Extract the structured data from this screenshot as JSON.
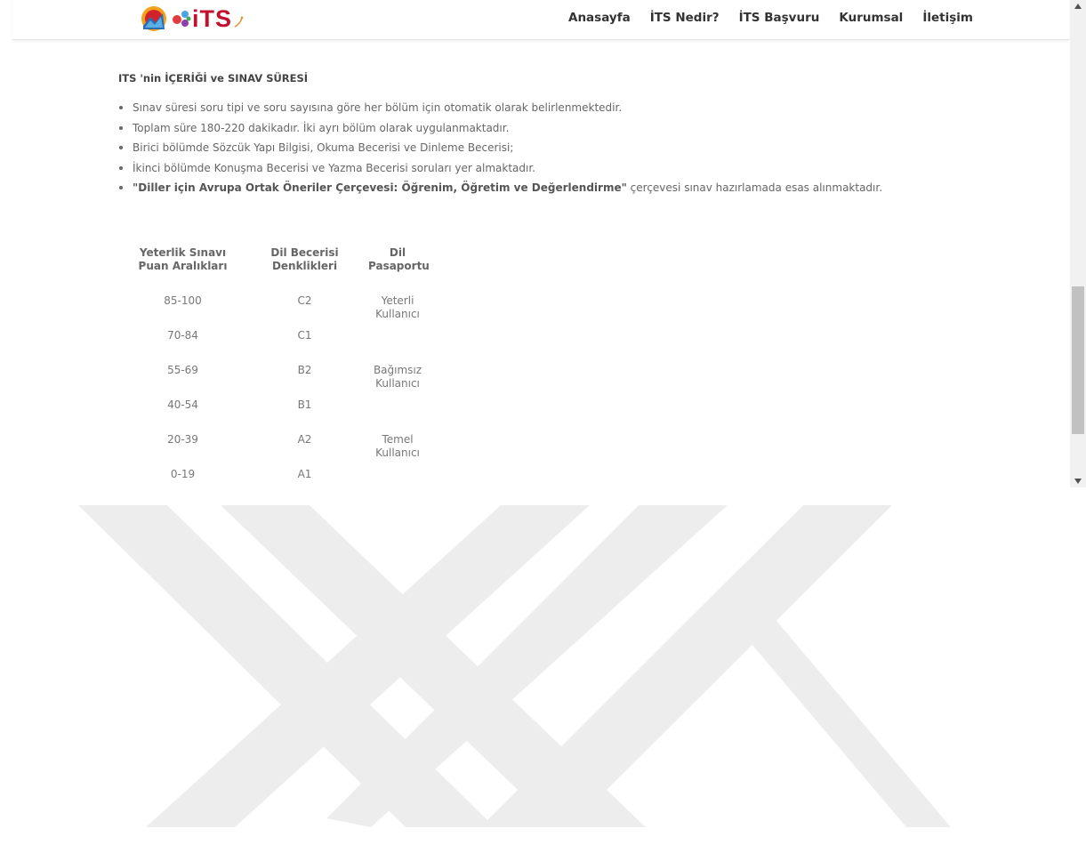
{
  "nav": {
    "logo_text": "iTS",
    "items": [
      "Anasayfa",
      "İTS Nedir?",
      "İTS Başvuru",
      "Kurumsal",
      "İletişim"
    ]
  },
  "section": {
    "title": "ITS 'nin İÇERİĞİ ve SINAV SÜRESİ",
    "bullets": [
      "Sınav süresi soru tipi ve soru sayısına göre her bölüm için otomatik olarak belirlenmektedir.",
      "Toplam süre 180-220 dakikadır. İki ayrı bölüm olarak uygulanmaktadır.",
      "Birici bölümde Sözcük Yapı Bilgisi, Okuma Becerisi ve Dinleme Becerisi;",
      "İkinci bölümde Konuşma Becerisi ve Yazma Becerisi soruları yer almaktadır."
    ],
    "last_bullet_bold": "\"Diller için Avrupa Ortak Öneriler Çerçevesi: Öğrenim, Öğretim ve Değerlendirme\"",
    "last_bullet_rest": " çerçevesi sınav hazırlamada esas alınmaktadır."
  },
  "table": {
    "headers": [
      "Yeterlik Sınavı Puan Aralıkları",
      "Dil Becerisi Denklikleri",
      "Dil Pasaportu"
    ],
    "rows": [
      [
        "85-100",
        "C2",
        "Yeterli Kullanıcı"
      ],
      [
        "70-84",
        "C1",
        ""
      ],
      [
        "55-69",
        "B2",
        "Bağımsız Kullanıcı"
      ],
      [
        "40-54",
        "B1",
        ""
      ],
      [
        "20-39",
        "A2",
        "Temel Kullanıcı"
      ],
      [
        "0-19",
        "A1",
        ""
      ]
    ]
  },
  "colors": {
    "logo_red": "#c2102f",
    "text": "#666666",
    "watermark": "#ededed"
  }
}
